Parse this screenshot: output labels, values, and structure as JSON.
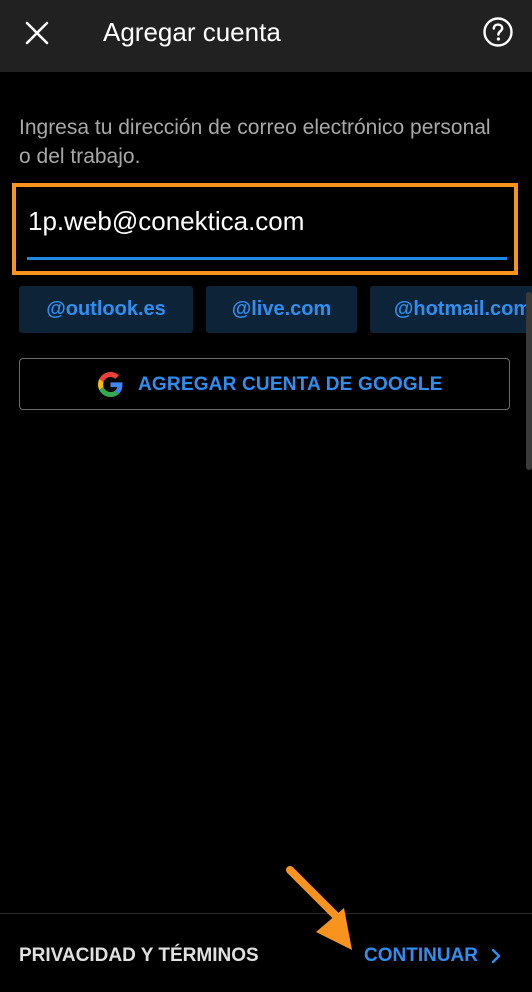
{
  "header": {
    "title": "Agregar cuenta",
    "close_icon": "close-icon",
    "help_icon": "help-icon"
  },
  "form": {
    "instructions": "Ingresa tu dirección de correo electrónico personal o del trabajo.",
    "email_value": "1p.web@conektica.com"
  },
  "suggestions": [
    "@outlook.es",
    "@live.com",
    "@hotmail.com"
  ],
  "google_button": {
    "label": "AGREGAR CUENTA DE GOOGLE",
    "icon": "google-icon"
  },
  "footer": {
    "privacy_label": "PRIVACIDAD Y TÉRMINOS",
    "continue_label": "CONTINUAR",
    "continue_icon": "chevron-right-icon"
  },
  "colors": {
    "accent": "#2f8ff0",
    "highlight": "#f7931e",
    "header_bg": "#212121"
  }
}
